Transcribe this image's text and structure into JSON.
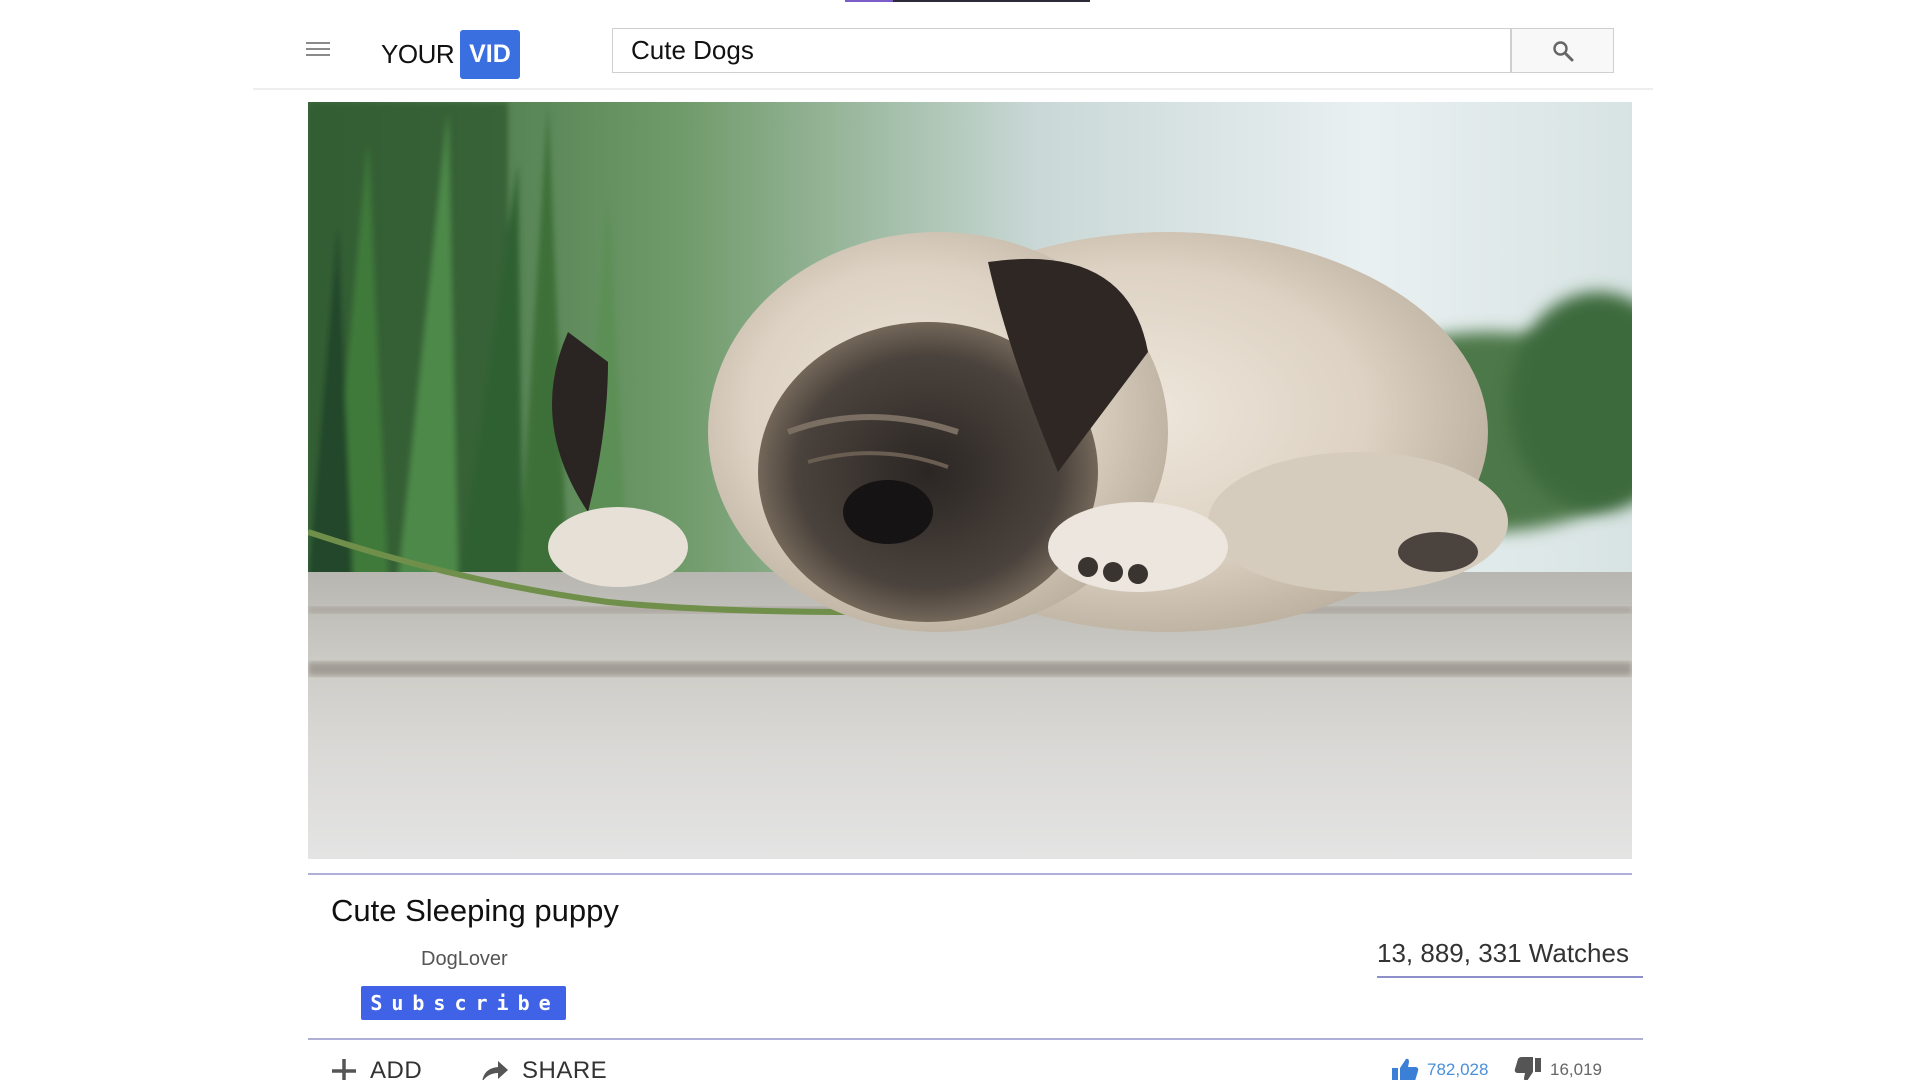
{
  "header": {
    "logo_left": "YOUR",
    "logo_right": "VID",
    "search_value": "Cute Dogs",
    "menu_icon": "hamburger-menu-icon",
    "search_icon": "magnifier-icon"
  },
  "video": {
    "title": "Cute Sleeping puppy",
    "channel": "DogLover",
    "subscribe_label": "Subscribe",
    "watches": "13, 889, 331 Watches"
  },
  "actions": {
    "add_label": "ADD",
    "share_label": "SHARE",
    "likes": "782,028",
    "dislikes": "16,019"
  },
  "colors": {
    "brand": "#3a6fe0",
    "subscribe": "#3f62e6",
    "like": "#4a8fd8",
    "divider": "#aeb0d8"
  }
}
